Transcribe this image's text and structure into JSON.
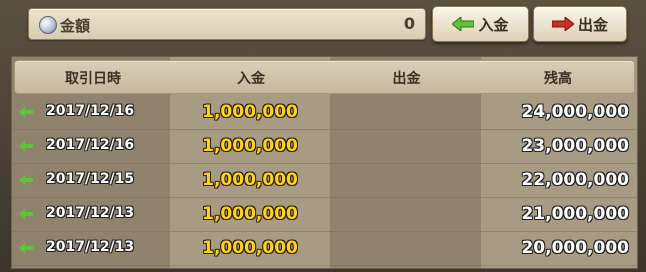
{
  "top": {
    "amount_label": "金額",
    "amount_value": "0",
    "deposit_label": "入金",
    "withdraw_label": "出金"
  },
  "table": {
    "headers": [
      "取引日時",
      "入金",
      "出金",
      "残高"
    ],
    "rows": [
      {
        "date": "2017/12/16",
        "deposit": "1,000,000",
        "withdraw": "",
        "balance": "24,000,000"
      },
      {
        "date": "2017/12/16",
        "deposit": "1,000,000",
        "withdraw": "",
        "balance": "23,000,000"
      },
      {
        "date": "2017/12/15",
        "deposit": "1,000,000",
        "withdraw": "",
        "balance": "22,000,000"
      },
      {
        "date": "2017/12/13",
        "deposit": "1,000,000",
        "withdraw": "",
        "balance": "21,000,000"
      },
      {
        "date": "2017/12/13",
        "deposit": "1,000,000",
        "withdraw": "",
        "balance": "20,000,000"
      }
    ]
  },
  "colors": {
    "deposit_arrow": "#5fc43a",
    "withdraw_arrow": "#c8321e",
    "deposit_text": "#ffd21e"
  }
}
